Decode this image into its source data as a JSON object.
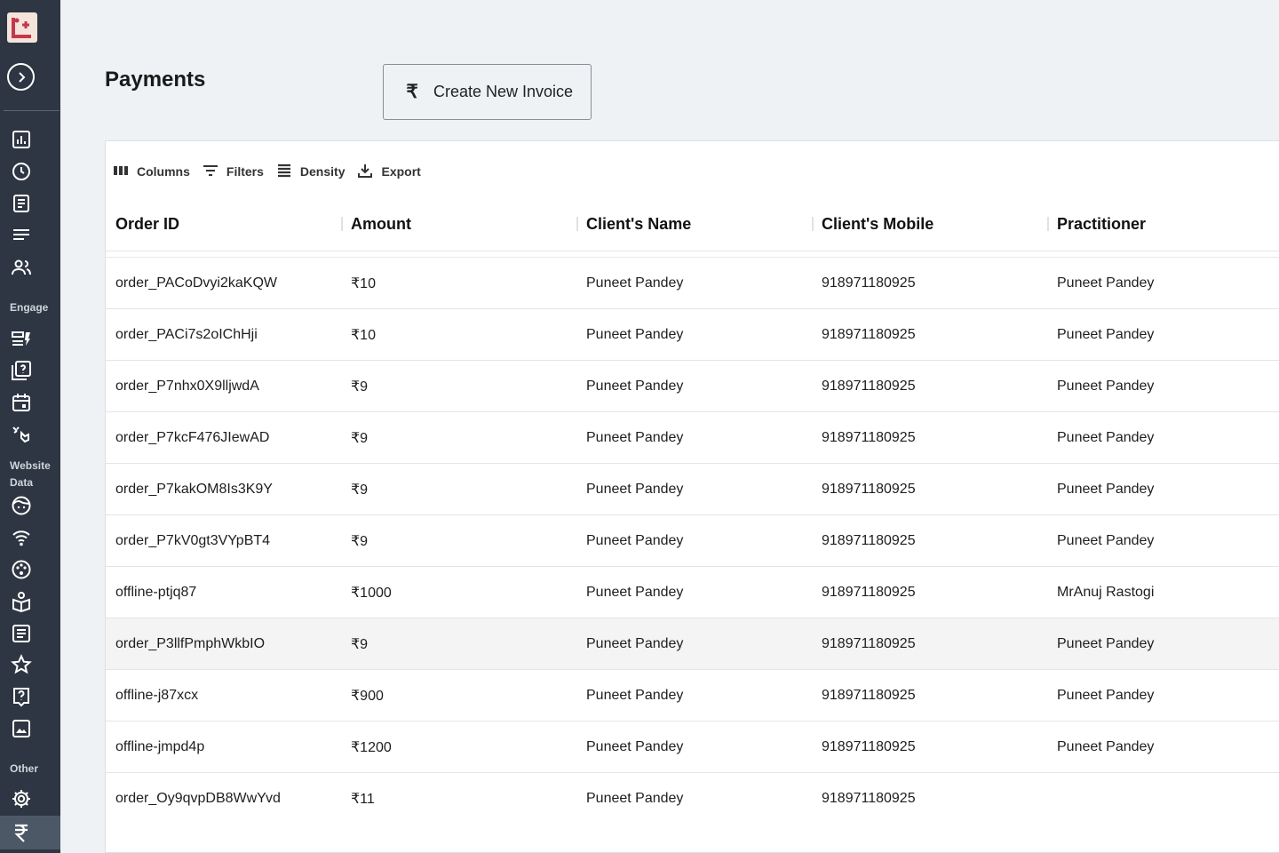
{
  "sidebar": {
    "logo_icon": "brand-logo-icon",
    "expand_icon": "chevron-right-circle-icon",
    "sections": [
      {
        "label": "Engage"
      },
      {
        "label": "Website Data"
      },
      {
        "label": "Other"
      }
    ],
    "active_color": "#4d5867",
    "background": "#2d3642"
  },
  "header": {
    "title": "Payments",
    "create_button": {
      "icon": "rupee-icon",
      "icon_glyph": "₹",
      "label": "Create New Invoice"
    }
  },
  "toolbar": {
    "columns": "Columns",
    "filters": "Filters",
    "density": "Density",
    "export": "Export"
  },
  "table": {
    "headers": [
      "Order ID",
      "Amount",
      "Client's Name",
      "Client's Mobile",
      "Practitioner"
    ],
    "rows": [
      [
        "order_PACoDvyi2kaKQW",
        "₹10",
        "Puneet Pandey",
        "918971180925",
        "Puneet Pandey"
      ],
      [
        "order_PACi7s2oIChHji",
        "₹10",
        "Puneet Pandey",
        "918971180925",
        "Puneet Pandey"
      ],
      [
        "order_P7nhx0X9lljwdA",
        "₹9",
        "Puneet Pandey",
        "918971180925",
        "Puneet Pandey"
      ],
      [
        "order_P7kcF476JIewAD",
        "₹9",
        "Puneet Pandey",
        "918971180925",
        "Puneet Pandey"
      ],
      [
        "order_P7kakOM8Is3K9Y",
        "₹9",
        "Puneet Pandey",
        "918971180925",
        "Puneet Pandey"
      ],
      [
        "order_P7kV0gt3VYpBT4",
        "₹9",
        "Puneet Pandey",
        "918971180925",
        "Puneet Pandey"
      ],
      [
        "offline-ptjq87",
        "₹1000",
        "Puneet Pandey",
        "918971180925",
        "MrAnuj Rastogi"
      ],
      [
        "order_P3llfPmphWkbIO",
        "₹9",
        "Puneet Pandey",
        "918971180925",
        "Puneet Pandey"
      ],
      [
        "offline-j87xcx",
        "₹900",
        "Puneet Pandey",
        "918971180925",
        "Puneet Pandey"
      ],
      [
        "offline-jmpd4p",
        "₹1200",
        "Puneet Pandey",
        "918971180925",
        "Puneet Pandey"
      ],
      [
        "order_Oy9qvpDB8WwYvd",
        "₹11",
        "Puneet Pandey",
        "918971180925",
        ""
      ]
    ],
    "highlighted_row": 7
  }
}
